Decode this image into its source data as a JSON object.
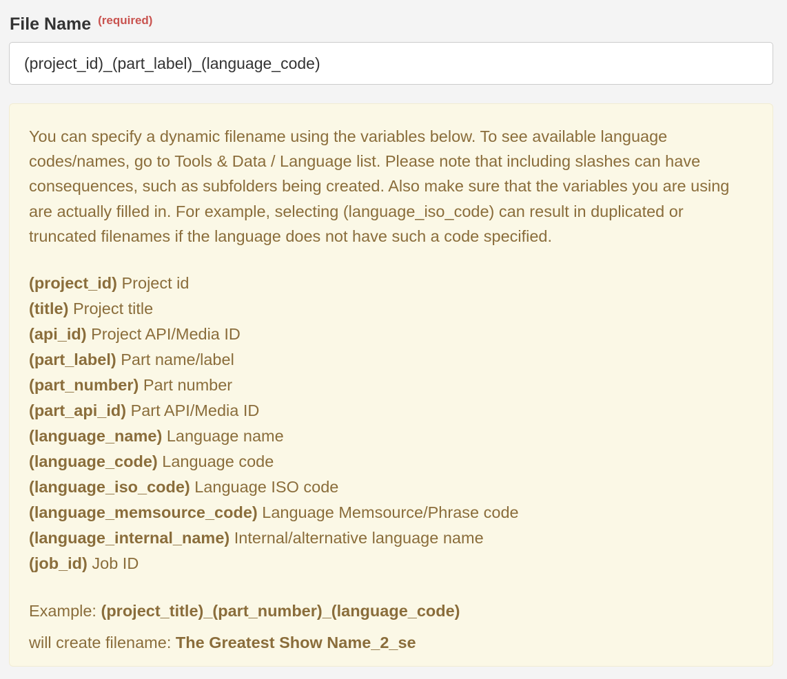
{
  "field": {
    "label": "File Name",
    "required_label": "(required)",
    "value": "(project_id)_(part_label)_(language_code)"
  },
  "help": {
    "intro": "You can specify a dynamic filename using the variables below. To see available language codes/names, go to Tools & Data / Language list. Please note that including slashes can have consequences, such as subfolders being created. Also make sure that the variables you are using are actually filled in. For example, selecting (language_iso_code) can result in duplicated or truncated filenames if the language does not have such a code specified.",
    "variables": [
      {
        "token": "(project_id)",
        "desc": "Project id"
      },
      {
        "token": "(title)",
        "desc": "Project title"
      },
      {
        "token": "(api_id)",
        "desc": "Project API/Media ID"
      },
      {
        "token": "(part_label)",
        "desc": "Part name/label"
      },
      {
        "token": "(part_number)",
        "desc": "Part number"
      },
      {
        "token": "(part_api_id)",
        "desc": "Part API/Media ID"
      },
      {
        "token": "(language_name)",
        "desc": "Language name"
      },
      {
        "token": "(language_code)",
        "desc": "Language code"
      },
      {
        "token": "(language_iso_code)",
        "desc": "Language ISO code"
      },
      {
        "token": "(language_memsource_code)",
        "desc": "Language Memsource/Phrase code"
      },
      {
        "token": "(language_internal_name)",
        "desc": "Internal/alternative language name"
      },
      {
        "token": "(job_id)",
        "desc": "Job ID"
      }
    ],
    "example_label": "Example:",
    "example_value": "(project_title)_(part_number)_(language_code)",
    "result_label": "will create filename:",
    "result_value": "The Greatest Show Name_2_se"
  },
  "colors": {
    "page_bg": "#f4f4f4",
    "help_bg": "#fbf8e6",
    "help_text": "#8a6d3b",
    "required": "#c9534f"
  }
}
